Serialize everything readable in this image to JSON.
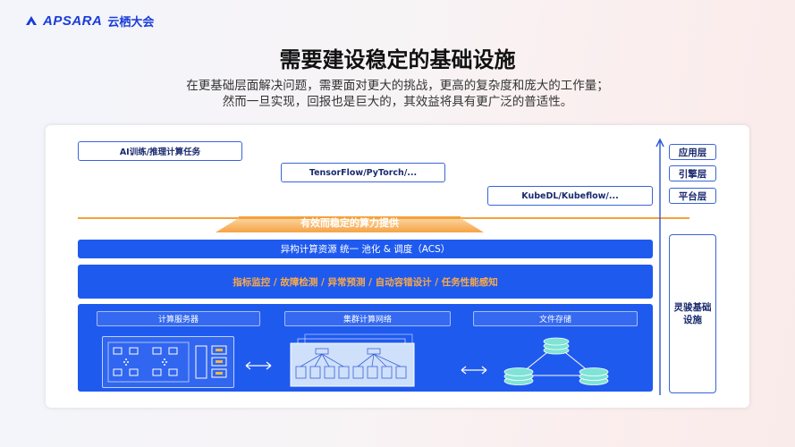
{
  "header": {
    "brand": "APSARA",
    "event": "云栖大会"
  },
  "title": "需要建设稳定的基础设施",
  "subtitle": {
    "line1": "在更基础层面解决问题，需要面对更大的挑战，更高的复杂度和庞大的工作量；",
    "line2": "然而一旦实现，回报也是巨大的，其效益将具有更广泛的普适性。"
  },
  "diagram": {
    "workloads": [
      "AI训练/推理计算任务",
      "TensorFlow/PyTorch/...",
      "KubeDL/Kubeflow/..."
    ],
    "arrow_banner": "有效而稳定的算力提供",
    "acs_band": "异构计算资源 统一 池化 & 调度（ACS）",
    "monitor_band": "指标监控 / 故障检测 / 异常预测 / 自动容错设计 / 任务性能感知",
    "infra": {
      "compute": "计算服务器",
      "network": "集群计算网络",
      "storage": "文件存储"
    },
    "layers": [
      "应用层",
      "引擎层",
      "平台层"
    ],
    "foundation": "灵骏基础设施"
  },
  "colors": {
    "primary": "#1f5aef",
    "accent_orange": "#f5a13b",
    "brand": "#1a3cd8"
  }
}
